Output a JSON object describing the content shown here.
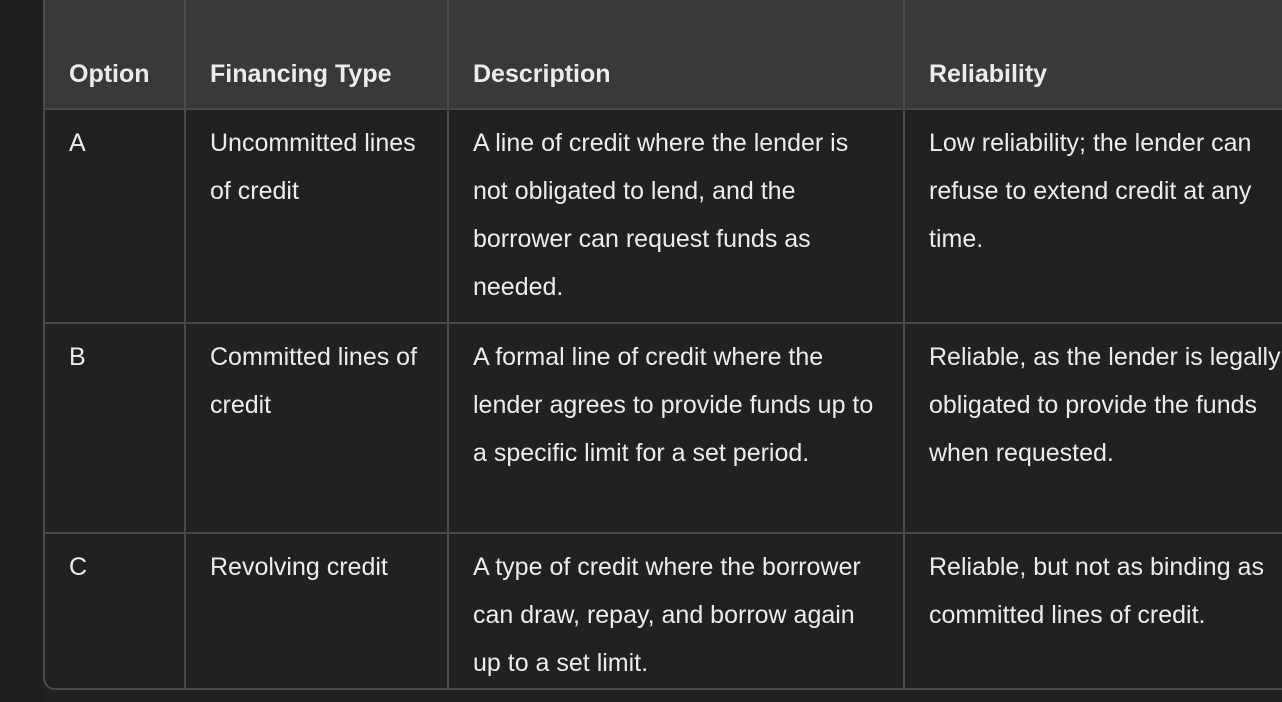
{
  "table": {
    "headers": [
      "Option",
      "Financing Type",
      "Description",
      "Reliability"
    ],
    "rows": [
      [
        "A",
        "Uncommitted lines of credit",
        "A line of credit where the lender is not obligated to lend, and the borrower can request funds as needed.",
        "Low reliability; the lender can refuse to extend credit at any time."
      ],
      [
        "B",
        "Committed lines of credit",
        "A formal line of credit where the lender agrees to provide funds up to a specific limit for a set period.",
        "Reliable, as the lender is legally obligated to provide the funds when requested."
      ],
      [
        "C",
        "Revolving credit",
        "A type of credit where the borrower can draw, repay, and borrow again up to a set limit.",
        "Reliable, but not as binding as committed lines of credit."
      ]
    ]
  }
}
